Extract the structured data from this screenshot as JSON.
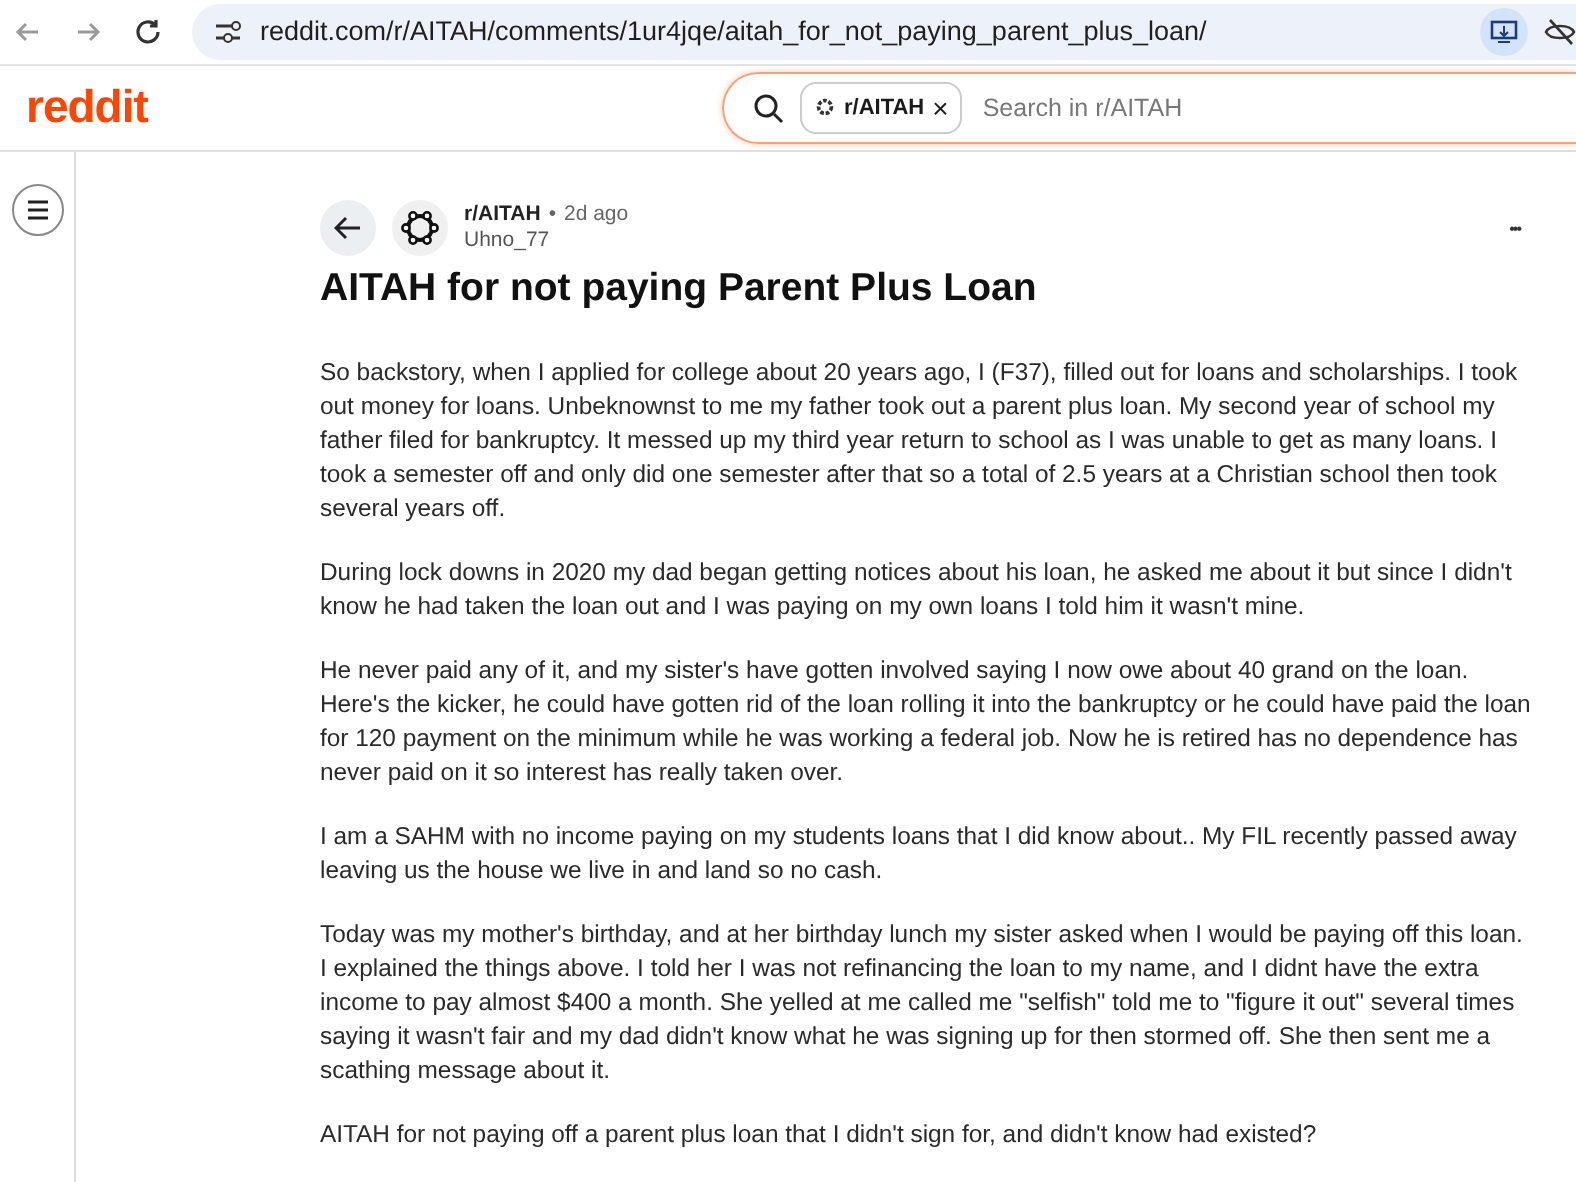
{
  "browser": {
    "url": "reddit.com/r/AITAH/comments/1ur4jqe/aitah_for_not_paying_parent_plus_loan/"
  },
  "header": {
    "logo": "reddit",
    "search": {
      "chip": "r/AITAH",
      "chip_close": "×",
      "placeholder": "Search in r/AITAH"
    }
  },
  "post": {
    "subreddit": "r/AITAH",
    "separator": "•",
    "age": "2d ago",
    "author": "Uhno_77",
    "more": "•••",
    "title": "AITAH for not paying Parent Plus Loan",
    "paragraphs": [
      "So backstory, when I applied for college about 20 years ago, I (F37), filled out for loans and scholarships. I took out money for loans. Unbeknownst to me my father took out a parent plus loan. My second year of school my father filed for bankruptcy. It messed up my third year return to school as I was unable to get as many loans. I took a semester off and only did one semester after that so a total of 2.5 years at a Christian school then took several years off.",
      "During lock downs in 2020 my dad began getting notices about his loan, he asked me about it but since I didn't know he had taken the loan out and I was paying on my own loans I told him it wasn't mine.",
      "He never paid any of it, and my sister's have gotten involved saying I now owe about 40 grand on the loan. Here's the kicker, he could have gotten rid of the loan rolling it into the bankruptcy or he could have paid the loan for 120 payment on the minimum while he was working a federal job. Now he is retired has no dependence has never paid on it so interest has really taken over.",
      "I am a SAHM with no income paying on my students loans that I did know about.. My FIL recently passed away leaving us the house we live in and land so no cash.",
      "Today was my mother's birthday, and at her birthday lunch my sister asked when I would be paying off this loan. I explained the things above. I told her I was not refinancing the loan to my name, and I didnt have the extra income to pay almost $400 a month. She yelled at me called me \"selfish\" told me to \"figure it out\" several times saying it wasn't fair and my dad didn't know what he was signing up for then stormed off. She then sent me a scathing message about it.",
      "AITAH for not paying off a parent plus loan that I didn't sign for, and didn't know had existed?"
    ]
  }
}
